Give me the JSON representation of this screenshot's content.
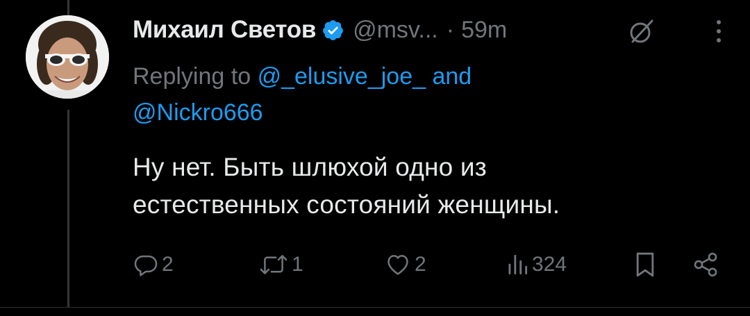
{
  "tweet": {
    "display_name": "Михаил Светов",
    "handle": "@msv...",
    "separator": "·",
    "time": "59m",
    "reply_prefix": "Replying to",
    "reply_mention_1": "@_elusive_joe_",
    "reply_and": "and",
    "reply_mention_2": "@Nickro666",
    "text_line_1": "Ну нет. Быть шлюхой одно из",
    "text_line_2": "естественных состояний женщины."
  },
  "actions": {
    "replies": "2",
    "reposts": "1",
    "likes": "2",
    "views": "324"
  },
  "colors": {
    "background": "#000000",
    "primary_text": "#e7e9ea",
    "secondary_text": "#71767b",
    "link": "#1d9bf0",
    "verified": "#1d9bf0"
  },
  "icons": {
    "verified": "verified-badge-icon",
    "grok": "grok-icon",
    "more": "more-vertical-icon",
    "reply": "reply-icon",
    "repost": "repost-icon",
    "like": "heart-icon",
    "views": "views-icon",
    "bookmark": "bookmark-icon",
    "share": "share-icon"
  }
}
